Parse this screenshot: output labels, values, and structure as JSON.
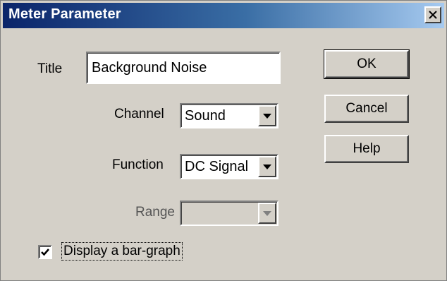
{
  "window": {
    "title": "Meter Parameter",
    "close_glyph": "✕"
  },
  "form": {
    "title_label": "Title",
    "title_value": "Background Noise",
    "channel_label": "Channel",
    "channel_value": "Sound",
    "function_label": "Function",
    "function_value": "DC Signal",
    "range_label": "Range",
    "range_value": "",
    "range_enabled": false,
    "bargraph_label": "Display a bar-graph",
    "bargraph_checked": true
  },
  "buttons": {
    "ok": "OK",
    "cancel": "Cancel",
    "help": "Help"
  },
  "colors": {
    "dialog_face": "#d4d0c8",
    "titlebar_start": "#0a246a",
    "titlebar_end": "#a6caf0"
  }
}
